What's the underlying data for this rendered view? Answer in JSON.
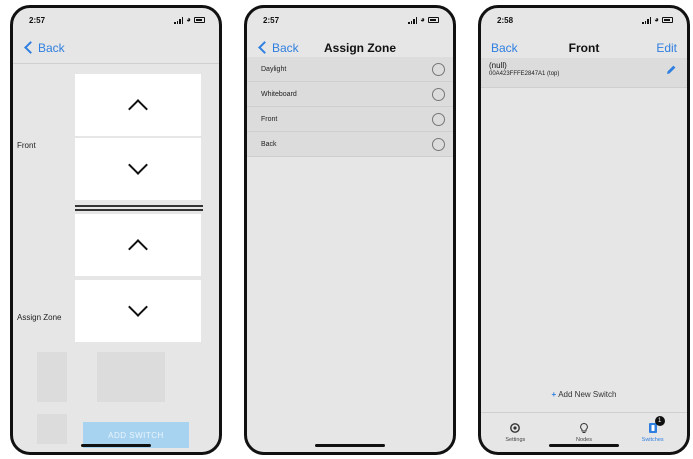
{
  "screens": [
    {
      "status_time": "2:57",
      "nav": {
        "back_label": "Back"
      },
      "labels": {
        "front": "Front",
        "assign_zone": "Assign Zone"
      },
      "add_switch_label": "ADD SWITCH"
    },
    {
      "status_time": "2:57",
      "nav": {
        "back_label": "Back",
        "title": "Assign Zone"
      },
      "zones": [
        "Daylight",
        "Whiteboard",
        "Front",
        "Back"
      ]
    },
    {
      "status_time": "2:58",
      "nav": {
        "back_label": "Back",
        "title": "Front",
        "edit_label": "Edit"
      },
      "switch": {
        "name": "(null)",
        "id": "00A423FFFE2847A1 (top)"
      },
      "add_new_label": "Add New Switch",
      "tabs": [
        {
          "label": "Settings",
          "icon": "settings-icon"
        },
        {
          "label": "Nodes",
          "icon": "lightbulb-icon"
        },
        {
          "label": "Switches",
          "icon": "switch-icon",
          "badge": "1"
        }
      ]
    }
  ],
  "colors": {
    "accent": "#2f7fe0",
    "disabled_button": "#a7d3f0",
    "background": "#e6e6e6"
  }
}
